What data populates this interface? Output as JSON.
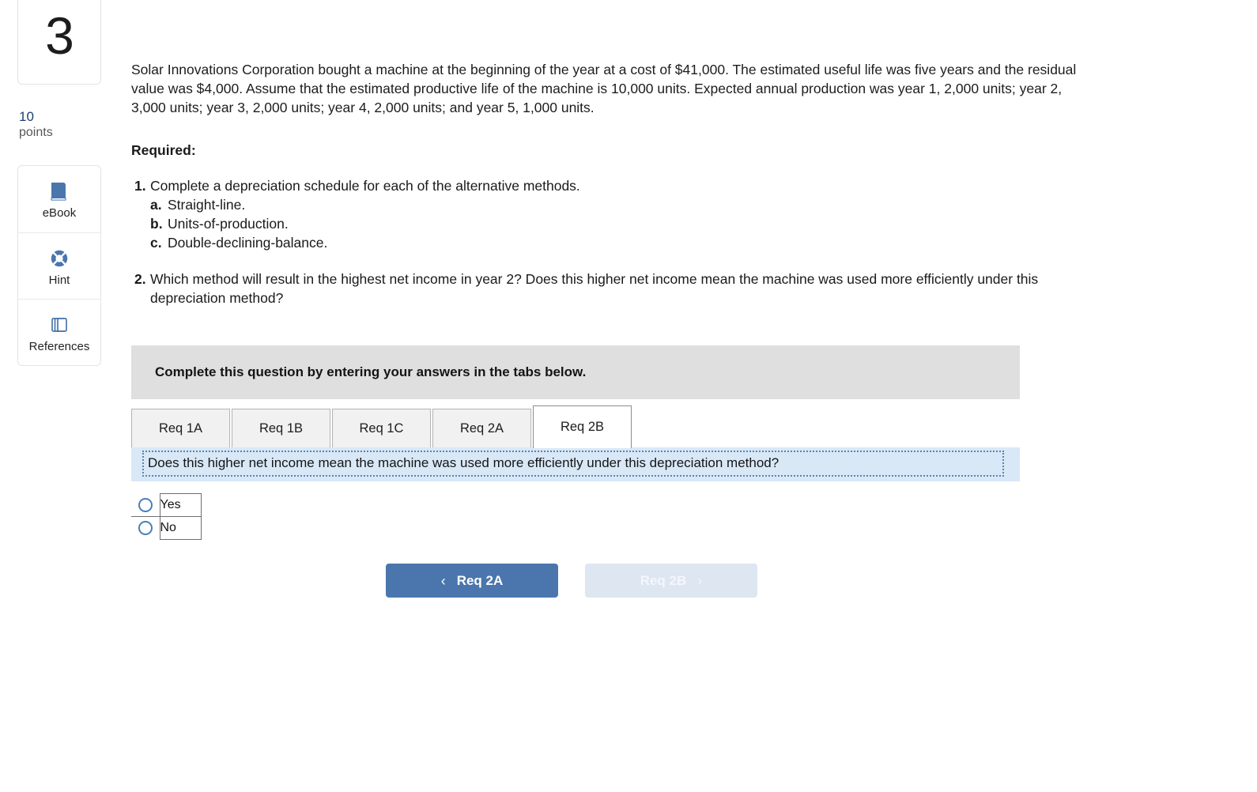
{
  "sidebar": {
    "question_number": "3",
    "points_value": "10",
    "points_label": "points",
    "tools": [
      {
        "label": "eBook",
        "icon": "ebook-icon"
      },
      {
        "label": "Hint",
        "icon": "lifebuoy-icon"
      },
      {
        "label": "References",
        "icon": "references-icon"
      }
    ]
  },
  "question": {
    "stem": "Solar Innovations Corporation bought a machine at the beginning of the year at a cost of $41,000. The estimated useful life was five years and the residual value was $4,000. Assume that the estimated productive life of the machine is 10,000 units. Expected annual production was year 1, 2,000 units; year 2, 3,000 units; year 3, 2,000 units; year 4, 2,000 units; and year 5, 1,000 units.",
    "required_heading": "Required:",
    "requirements": [
      {
        "marker": "1.",
        "text": "Complete a depreciation schedule for each of the alternative methods.",
        "subitems": [
          {
            "marker": "a.",
            "text": "Straight-line."
          },
          {
            "marker": "b.",
            "text": "Units-of-production."
          },
          {
            "marker": "c.",
            "text": "Double-declining-balance."
          }
        ]
      },
      {
        "marker": "2.",
        "text": "Which method will result in the highest net income in year 2? Does this higher net income mean the machine was used more efficiently under this depreciation method?",
        "subitems": []
      }
    ]
  },
  "banner": {
    "text": "Complete this question by entering your answers in the tabs below."
  },
  "tabs": [
    {
      "label": "Req 1A",
      "active": false
    },
    {
      "label": "Req 1B",
      "active": false
    },
    {
      "label": "Req 1C",
      "active": false
    },
    {
      "label": "Req 2A",
      "active": false
    },
    {
      "label": "Req 2B",
      "active": true
    }
  ],
  "answer_panel": {
    "prompt": "Does this higher net income mean the machine was used more efficiently under this depreciation method?",
    "options": [
      {
        "label": "Yes",
        "selected": false
      },
      {
        "label": "No",
        "selected": false
      }
    ]
  },
  "nav": {
    "prev_label": "Req 2A",
    "prev_chevron": "‹",
    "next_label": "Req 2B",
    "next_chevron": "›"
  },
  "colors": {
    "accent_blue": "#4a76ad",
    "banner_gray": "#dfdfdf",
    "prompt_blue": "#d9e8f7",
    "points_blue": "#1c3f73"
  }
}
